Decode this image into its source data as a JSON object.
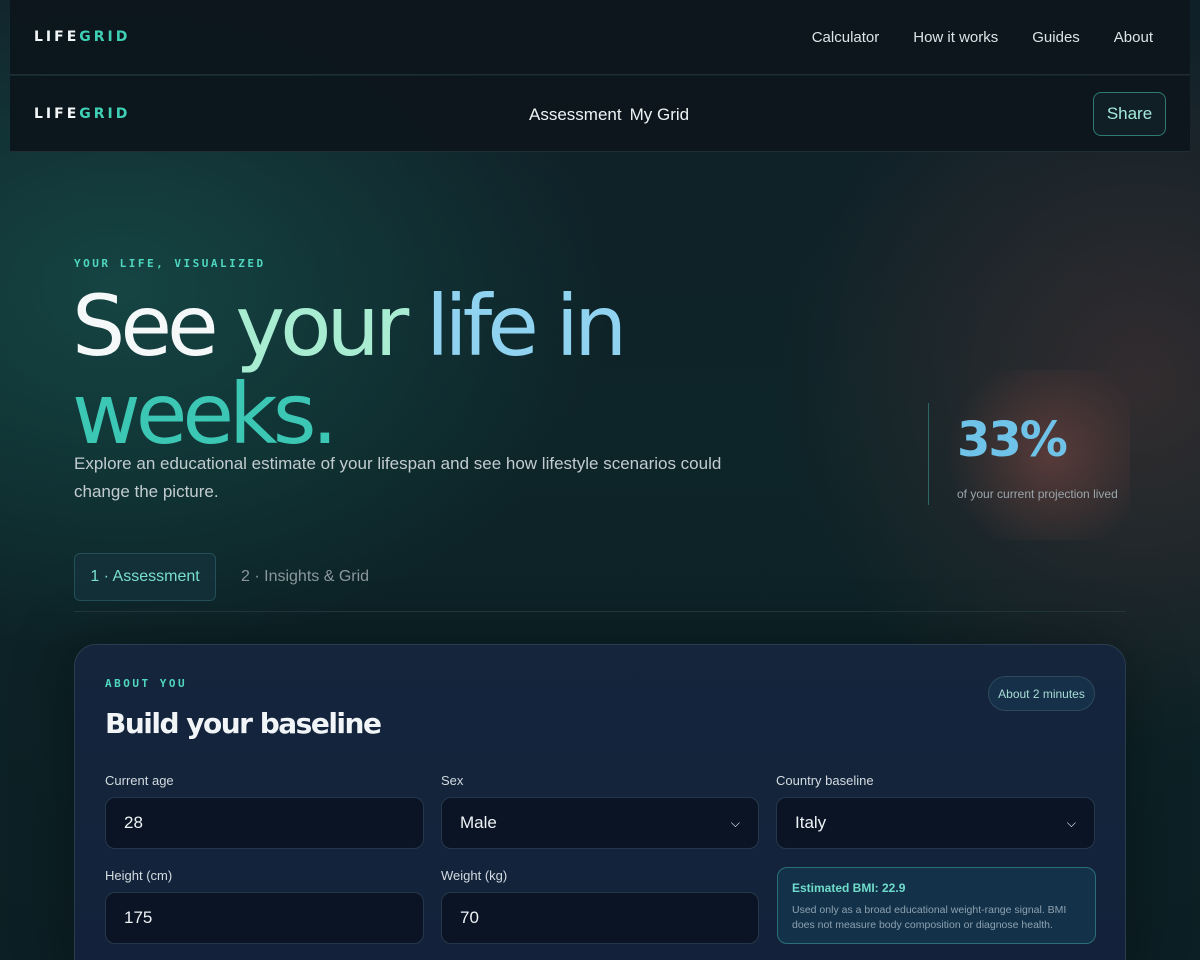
{
  "brand": {
    "name_a": "LIFE",
    "name_b": "GRID"
  },
  "topnav": {
    "links": [
      "Calculator",
      "How it works",
      "Guides",
      "About"
    ]
  },
  "subnav": {
    "tabs": [
      "Assessment",
      "My Grid"
    ],
    "share_label": "Share"
  },
  "hero": {
    "eyebrow": "YOUR LIFE, VISUALIZED",
    "headline_words": [
      "See",
      "your",
      "life",
      "in",
      "weeks."
    ],
    "lede": "Explore an educational estimate of your lifespan and see how lifestyle scenarios could change the picture."
  },
  "stat": {
    "value": "33%",
    "label": "of your current projection lived"
  },
  "steps": {
    "active": "1 · Assessment",
    "next": "2 · Insights & Grid"
  },
  "card": {
    "eyebrow": "ABOUT YOU",
    "title": "Build your baseline",
    "duration": "About 2 minutes",
    "fields": {
      "age": {
        "label": "Current age",
        "value": "28"
      },
      "sex": {
        "label": "Sex",
        "value": "Male"
      },
      "country": {
        "label": "Country baseline",
        "value": "Italy"
      },
      "height": {
        "label": "Height (cm)",
        "value": "175"
      },
      "weight": {
        "label": "Weight (kg)",
        "value": "70"
      }
    },
    "bmi": {
      "title": "Estimated BMI: 22.9",
      "note": "Used only as a broad educational weight-range signal. BMI does not measure body composition or diagnose health."
    }
  },
  "colors": {
    "accent": "#3fd1b6",
    "background": "#0b1b22",
    "card": "#14253c"
  }
}
